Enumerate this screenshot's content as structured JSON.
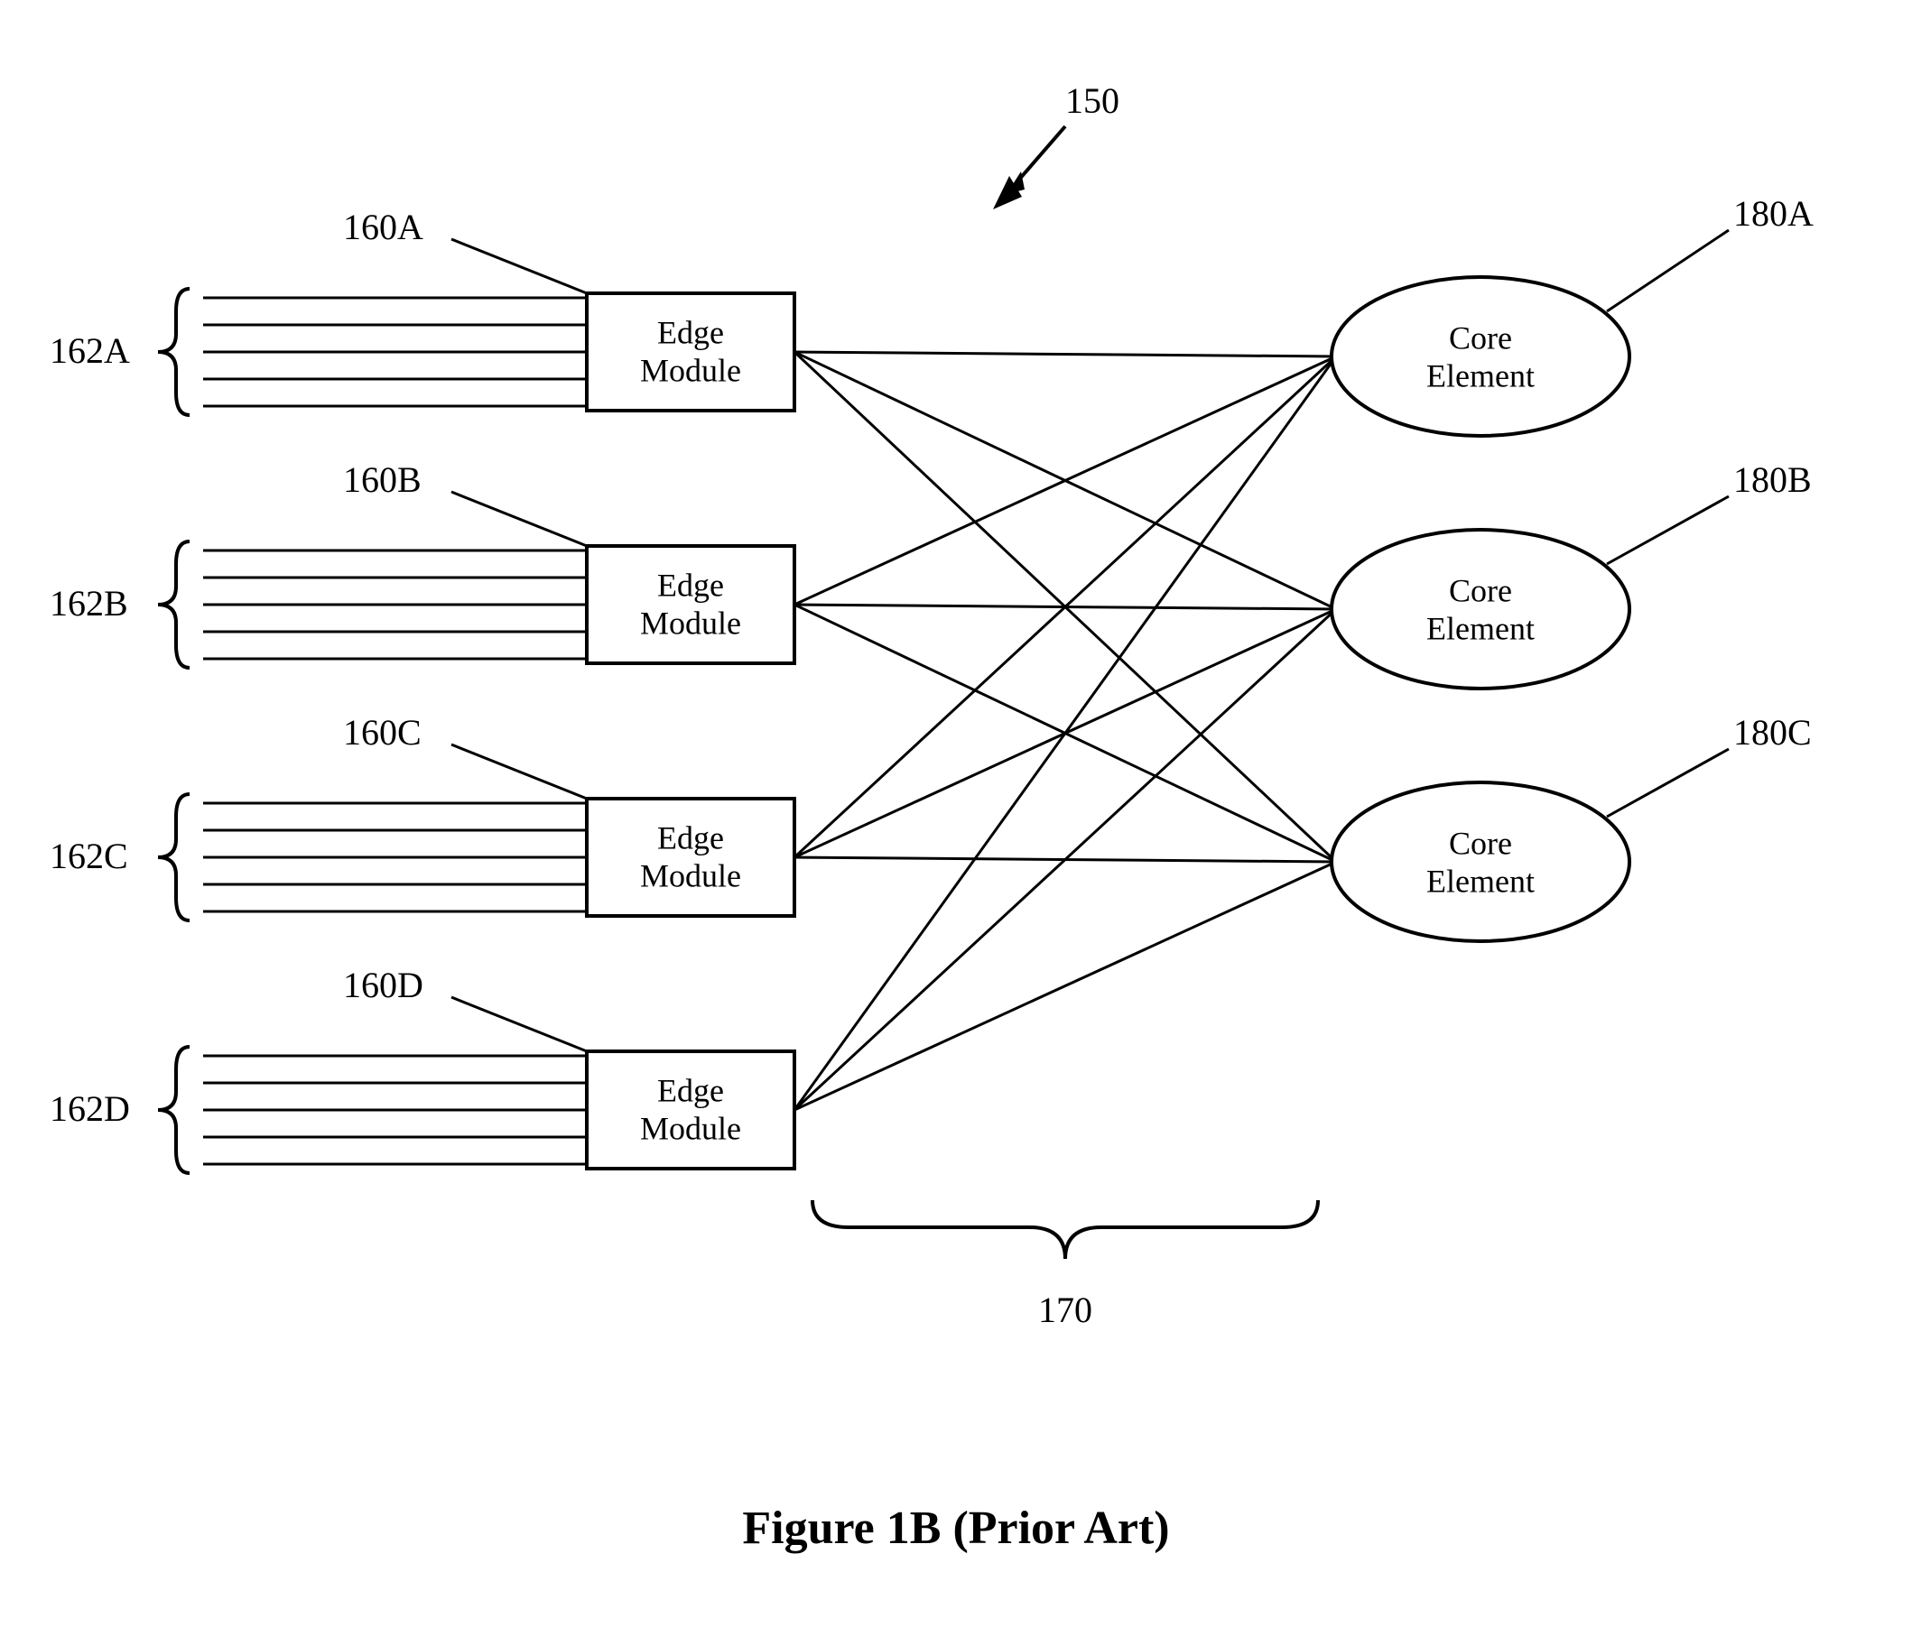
{
  "figure": {
    "ref_top": "150",
    "caption": "Figure 1B  (Prior Art)",
    "bottom_brace_ref": "170"
  },
  "edge_modules": [
    {
      "box_label_line1": "Edge",
      "box_label_line2": "Module",
      "ref": "160A",
      "brace_ref": "162A"
    },
    {
      "box_label_line1": "Edge",
      "box_label_line2": "Module",
      "ref": "160B",
      "brace_ref": "162B"
    },
    {
      "box_label_line1": "Edge",
      "box_label_line2": "Module",
      "ref": "160C",
      "brace_ref": "162C"
    },
    {
      "box_label_line1": "Edge",
      "box_label_line2": "Module",
      "ref": "160D",
      "brace_ref": "162D"
    }
  ],
  "core_elements": [
    {
      "label_line1": "Core",
      "label_line2": "Element",
      "ref": "180A"
    },
    {
      "label_line1": "Core",
      "label_line2": "Element",
      "ref": "180B"
    },
    {
      "label_line1": "Core",
      "label_line2": "Element",
      "ref": "180C"
    }
  ]
}
